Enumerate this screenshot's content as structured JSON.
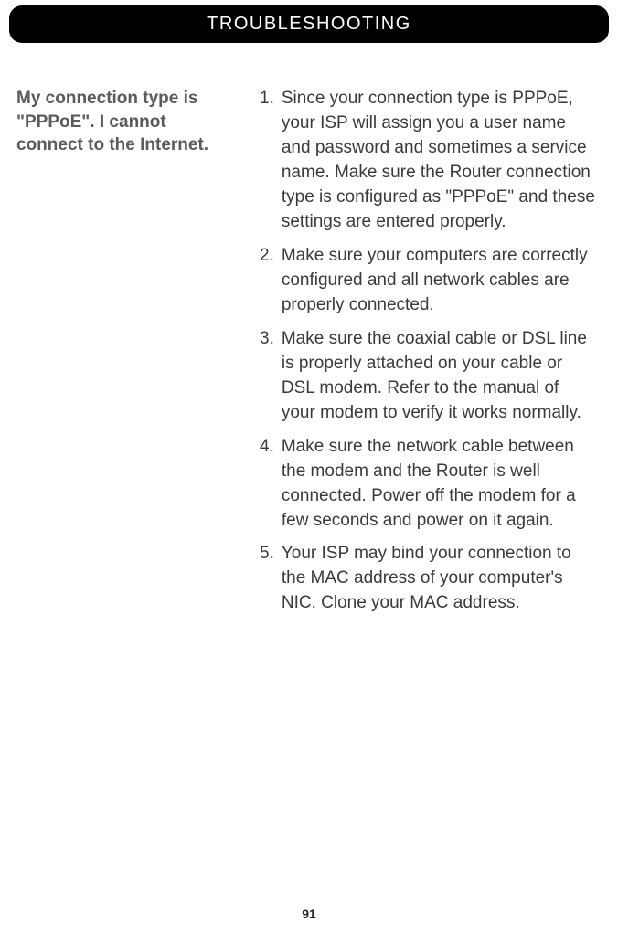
{
  "header": {
    "title": "TROUBLESHOOTING"
  },
  "problem": {
    "title": "My connection type is \"PPPoE\". I cannot connect to the Internet."
  },
  "steps": [
    {
      "num": "1.",
      "text": "Since your connection type is PPPoE, your ISP will assign you a user name and password and sometimes a service name. Make sure the Router connection type is configured as \"PPPoE\" and these settings are entered properly."
    },
    {
      "num": "2.",
      "text": "Make sure your computers are correctly configured and all network cables are properly connected."
    },
    {
      "num": "3.",
      "text": "Make sure the coaxial cable or DSL line is properly attached on your cable or DSL modem. Refer to the manual of your modem to verify it works normally."
    },
    {
      "num": "4.",
      "text": "Make sure the network cable between the modem and the Router is well connected. Power off the modem for a few seconds and power on it again."
    },
    {
      "num": "5.",
      "text": "Your ISP may bind your connection to the MAC address of your computer's NIC. Clone your MAC address."
    }
  ],
  "pageNumber": "91"
}
